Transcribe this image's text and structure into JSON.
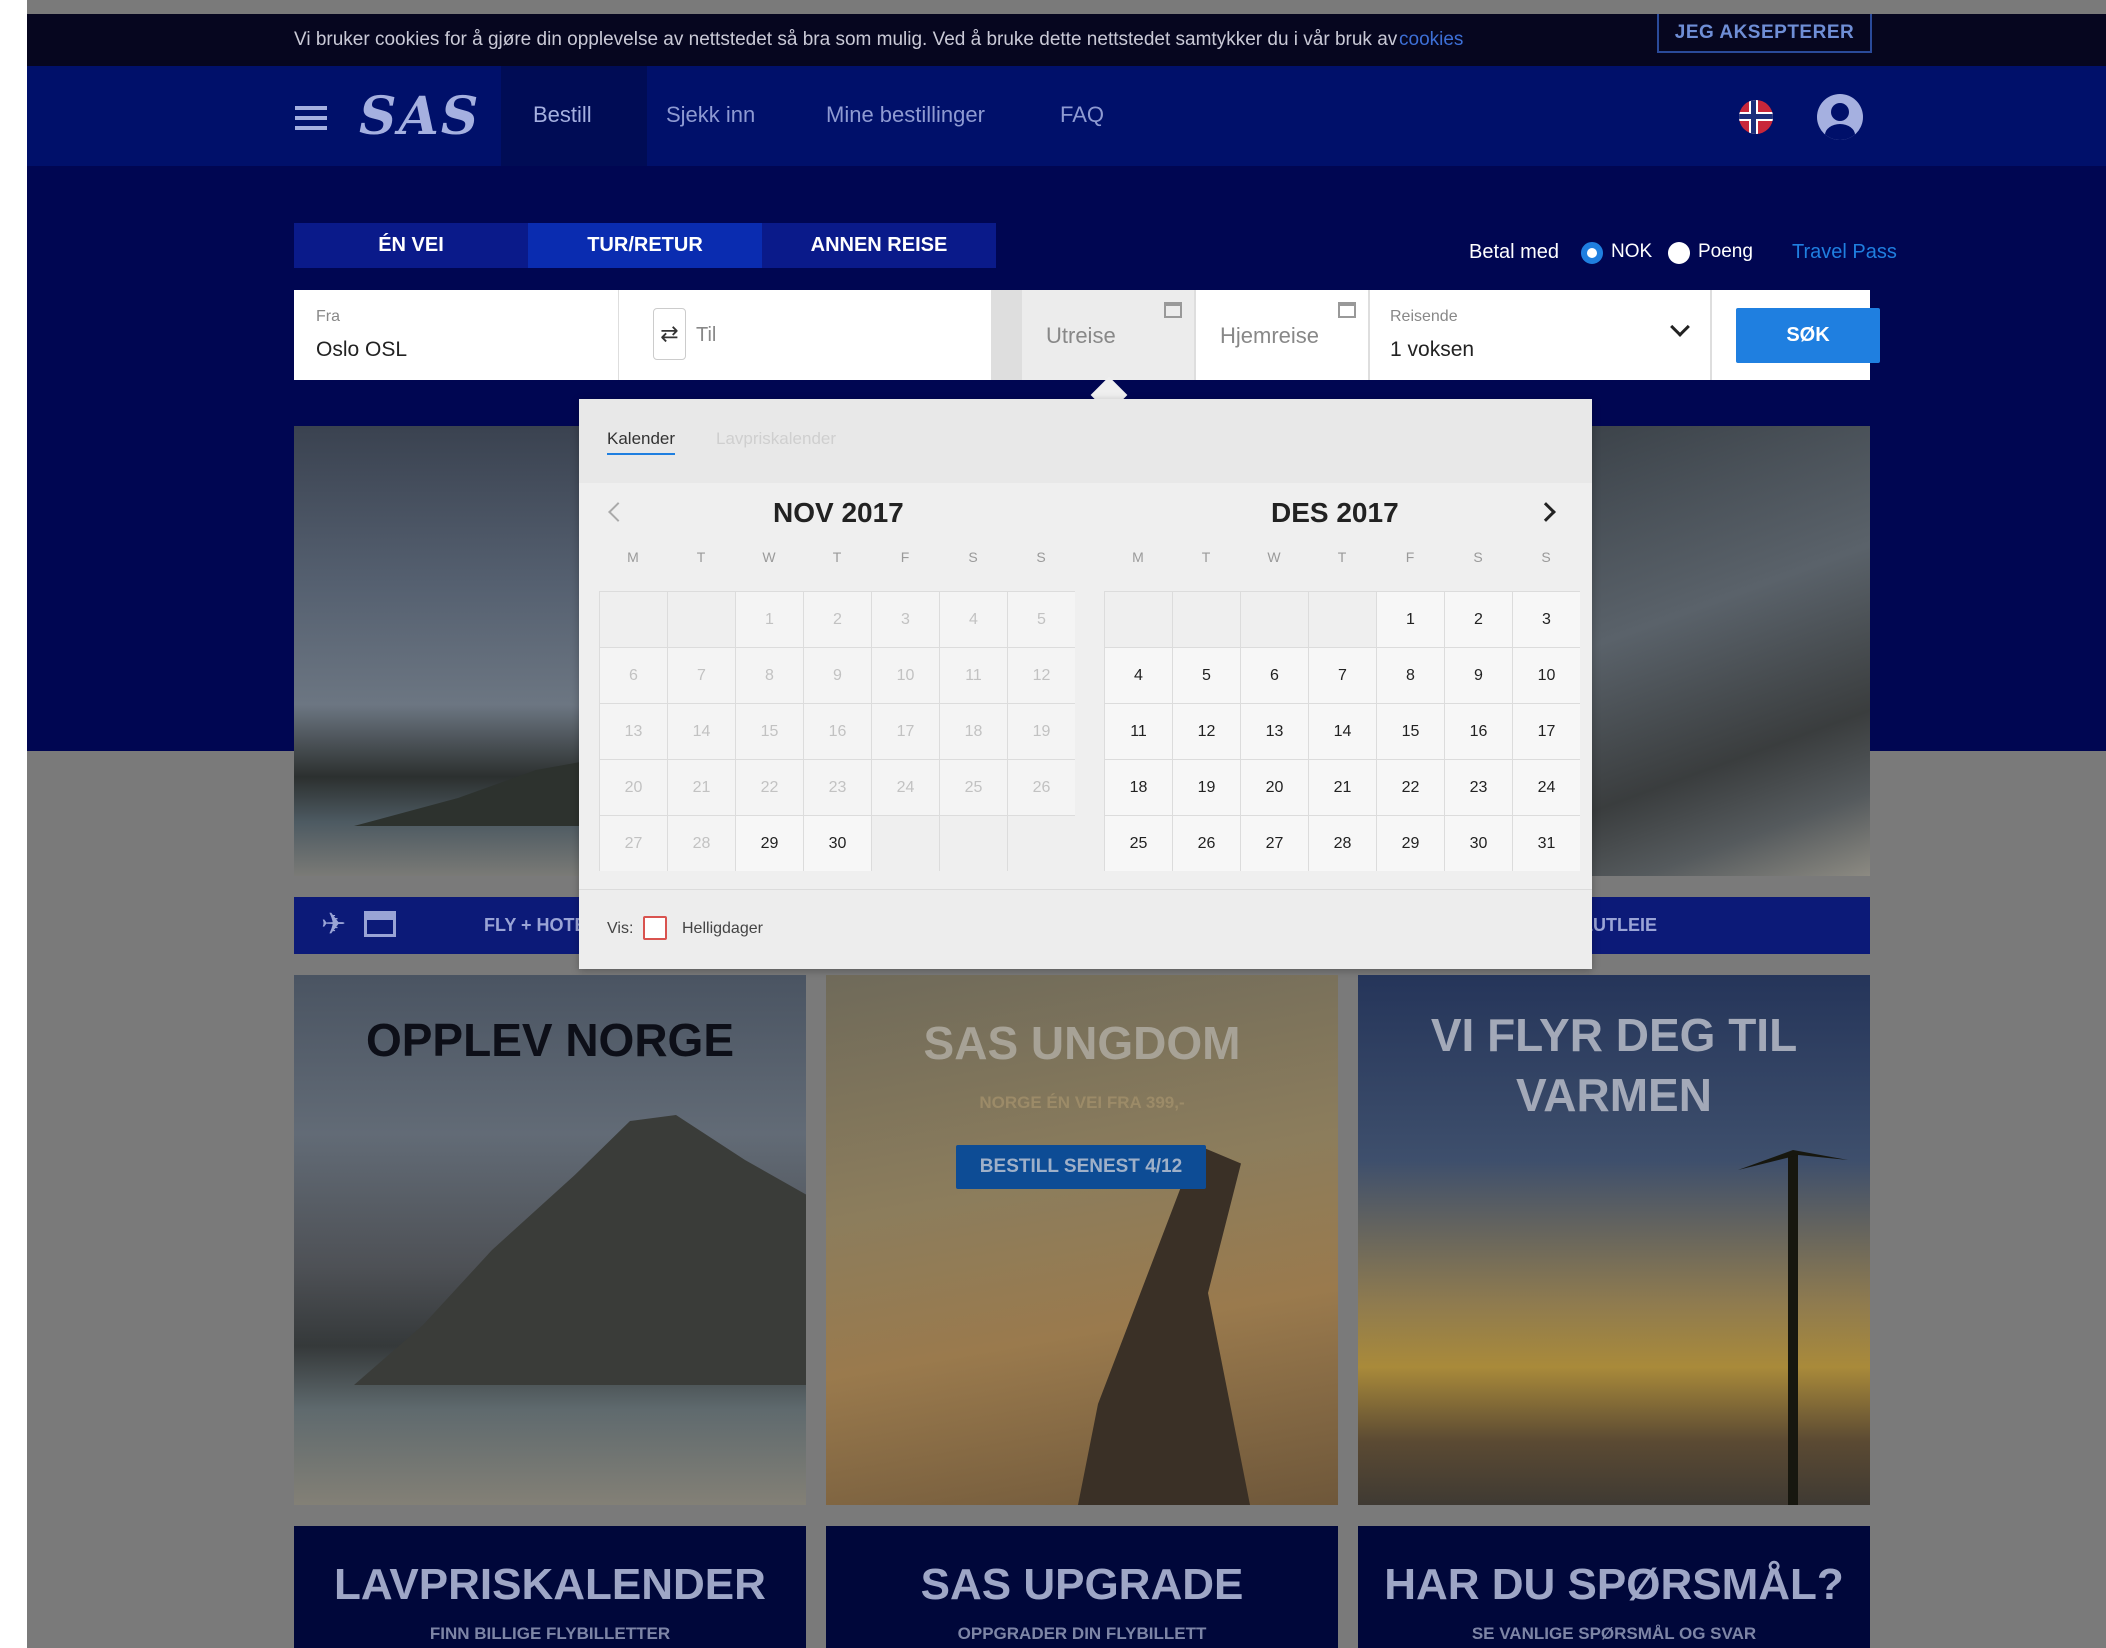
{
  "cookie": {
    "text": "Vi bruker cookies for å gjøre din opplevelse av nettstedet så bra som mulig. Ved å bruke dette nettstedet samtykker du i vår bruk av",
    "link": "cookies",
    "accept": "JEG AKSEPTERER"
  },
  "nav": {
    "logo": "SAS",
    "items": [
      "Bestill",
      "Sjekk inn",
      "Mine bestillinger",
      "FAQ"
    ]
  },
  "trip_tabs": [
    "ÉN VEI",
    "TUR/RETUR",
    "ANNEN REISE"
  ],
  "payment": {
    "label": "Betal med",
    "opt1": "NOK",
    "opt2": "Poeng",
    "link": "Travel Pass"
  },
  "search": {
    "from_label": "Fra",
    "from_value": "Oslo OSL",
    "to_placeholder": "Til",
    "out_placeholder": "Utreise",
    "home_placeholder": "Hjemreise",
    "pax_label": "Reisende",
    "pax_value": "1 voksen",
    "button": "SØK"
  },
  "calendar": {
    "tab_active": "Kalender",
    "tab_other": "Lavpriskalender",
    "left": {
      "month": "NOV 2017",
      "offset": 2,
      "days": 30,
      "active_from": 29
    },
    "right": {
      "month": "DES 2017",
      "offset": 4,
      "days": 31,
      "active_from": 1
    },
    "weekdays": [
      "M",
      "T",
      "W",
      "T",
      "F",
      "S",
      "S"
    ],
    "show_label": "Vis:",
    "holidays": "Helligdager"
  },
  "product_bar": {
    "left": "FLY + HOTELL",
    "right": "BILUTLEIE"
  },
  "cards": [
    {
      "title": "OPPLEV NORGE"
    },
    {
      "title": "SAS UNGDOM",
      "sub": "NORGE ÉN VEI FRA 399,-",
      "button": "BESTILL SENEST 4/12"
    },
    {
      "title_l1": "VI FLYR DEG TIL",
      "title_l2": "VARMEN"
    }
  ],
  "bottom_cards": [
    {
      "title": "LAVPRISKALENDER",
      "sub": "FINN BILLIGE FLYBILLETTER"
    },
    {
      "title": "SAS UPGRADE",
      "sub": "OPPGRADER DIN FLYBILLETT"
    },
    {
      "title": "HAR DU SPØRSMÅL?",
      "sub": "SE VANLIGE SPØRSMÅL OG SVAR"
    }
  ],
  "colors": {
    "brand": "#00106a",
    "accent": "#1f7fe0"
  }
}
